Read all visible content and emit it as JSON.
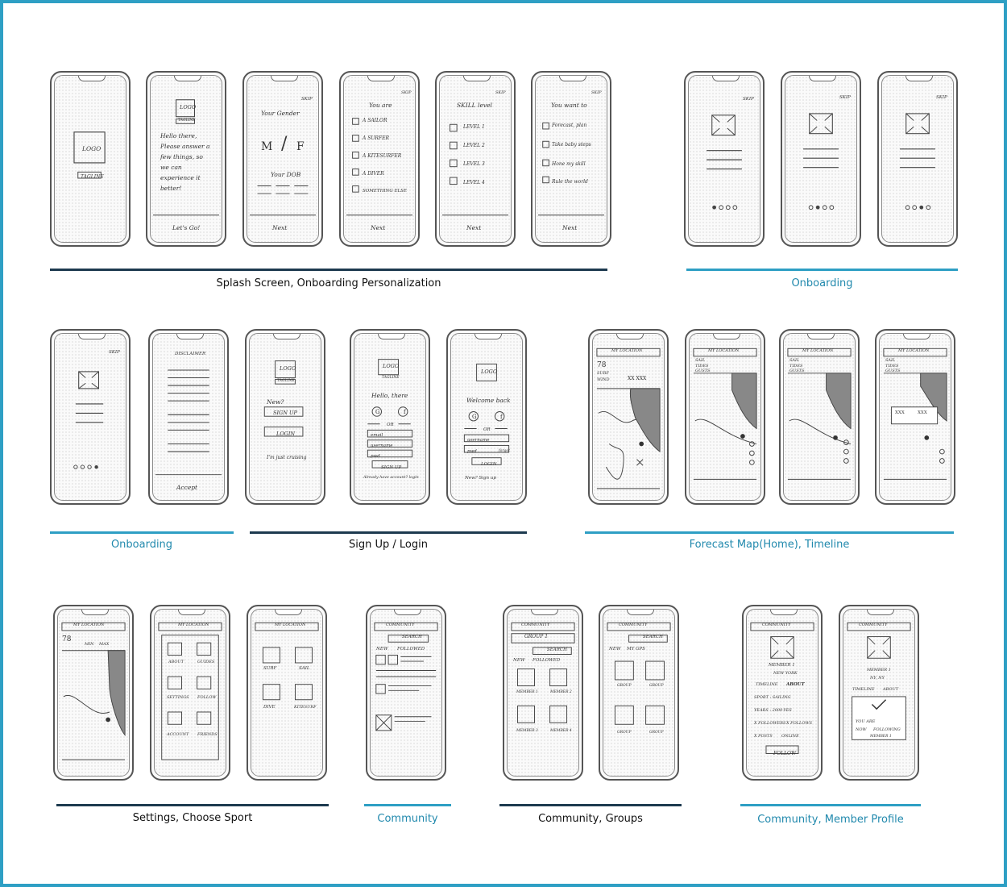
{
  "captions": [
    {
      "text": "Splash Screen, Onboarding Personalization",
      "tone": "dark"
    },
    {
      "text": "Onboarding",
      "tone": "blue"
    },
    {
      "text": "Onboarding",
      "tone": "blue"
    },
    {
      "text": "Sign Up / Login",
      "tone": "dark"
    },
    {
      "text": "Forecast Map(Home), Timeline",
      "tone": "blue"
    },
    {
      "text": "Settings, Choose Sport",
      "tone": "dark"
    },
    {
      "text": "Community",
      "tone": "blue"
    },
    {
      "text": "Community, Groups",
      "tone": "dark"
    },
    {
      "text": "Community, Member Profile",
      "tone": "blue"
    }
  ],
  "colors": {
    "frame_border": "#2e9fc4",
    "bar_dark": "#1d3a4f",
    "bar_blue": "#2e9fc4",
    "caption_blue": "#2189ad"
  },
  "screens": [
    {
      "id": "splash",
      "texts": [
        "LOGO",
        "TAGLINE"
      ]
    },
    {
      "id": "welcome",
      "texts": [
        "LOGO",
        "TAGLINE",
        "Hello there,",
        "Please answer a",
        "few things, so",
        "we can",
        "experience it",
        "better!",
        "Let's Go!"
      ]
    },
    {
      "id": "gender",
      "texts": [
        "SKIP",
        "Your Gender",
        "M",
        "/",
        "F",
        "Your DOB",
        "Next"
      ]
    },
    {
      "id": "you-are",
      "texts": [
        "SKIP",
        "You are",
        "A SAILOR",
        "A SURFER",
        "A KITESURFER",
        "A DIVER",
        "SOMETHING ELSE",
        "Next"
      ]
    },
    {
      "id": "skill",
      "texts": [
        "SKIP",
        "SKILL level",
        "LEVEL 1",
        "LEVEL 2",
        "LEVEL 3",
        "LEVEL 4",
        "Next"
      ]
    },
    {
      "id": "want-to",
      "texts": [
        "SKIP",
        "You want to",
        "Forecast, plan",
        "Take baby steps",
        "Hone my skill",
        "Rule the world",
        "Next"
      ]
    },
    {
      "id": "onb-1",
      "texts": [
        "SKIP"
      ]
    },
    {
      "id": "onb-2",
      "texts": [
        "SKIP"
      ]
    },
    {
      "id": "onb-3",
      "texts": [
        "SKIP"
      ]
    },
    {
      "id": "onb-4",
      "texts": [
        "SKIP"
      ]
    },
    {
      "id": "disclaimer",
      "texts": [
        "DISCLAIMER",
        "Accept"
      ]
    },
    {
      "id": "signup-choice",
      "texts": [
        "LOGO",
        "TAGLINE",
        "New?",
        "SIGN UP",
        "LOGIN",
        "I'm just cruising"
      ]
    },
    {
      "id": "signup",
      "texts": [
        "LOGO",
        "TAGLINE",
        "Hello, there",
        "G",
        "f",
        "OR",
        "email",
        "username",
        "pwd",
        "SIGN UP",
        "Already have account? login"
      ]
    },
    {
      "id": "login",
      "texts": [
        "LOGO",
        "Welcome back",
        "G",
        "f",
        "OR",
        "username",
        "pwd",
        "forgot",
        "LOGIN",
        "New? Sign up"
      ]
    },
    {
      "id": "map-home",
      "texts": [
        "MY LOCATION",
        "78",
        "SURF",
        "WIND",
        "XX XXX"
      ]
    },
    {
      "id": "timeline-1",
      "texts": [
        "MY LOCATION",
        "SAIL",
        "TIDES",
        "GUSTS"
      ]
    },
    {
      "id": "timeline-2",
      "texts": [
        "MY LOCATION",
        "SAIL",
        "TIDES",
        "GUSTS"
      ]
    },
    {
      "id": "timeline-3",
      "texts": [
        "MY LOCATION",
        "SAIL",
        "TIDES",
        "GUSTS",
        "XXX",
        "XXX"
      ]
    },
    {
      "id": "settings-map",
      "texts": [
        "MY LOCATION",
        "78",
        "MIN",
        "MAX"
      ]
    },
    {
      "id": "settings",
      "texts": [
        "MY LOCATION",
        "ABOUT",
        "GUIDES",
        "SETTINGS",
        "FOLLOW",
        "ACCOUNT",
        "FRIENDS"
      ]
    },
    {
      "id": "choose-sport",
      "texts": [
        "MY LOCATION",
        "SURF",
        "SAIL",
        "DIVE",
        "KITESURF"
      ]
    },
    {
      "id": "community",
      "texts": [
        "COMMUNITY",
        "SEARCH",
        "NEW",
        "FOLLOWED"
      ]
    },
    {
      "id": "groups-1",
      "texts": [
        "COMMUNITY",
        "GROUP 1",
        "SEARCH",
        "NEW",
        "FOLLOWED",
        "MEMBER 1",
        "MEMBER 2",
        "MEMBER 3",
        "MEMBER 4"
      ]
    },
    {
      "id": "groups-2",
      "texts": [
        "COMMUNITY",
        "SEARCH",
        "NEW",
        "MY GPS",
        "GROUP",
        "GROUP",
        "GROUP",
        "GROUP"
      ]
    },
    {
      "id": "member-1",
      "texts": [
        "COMMUNITY",
        "MEMBER 1",
        "NEW YORK",
        "TIMELINE",
        "ABOUT",
        "SPORT : SAILING",
        "YEARS : 2000-YES",
        "X FOLLOWERS",
        "X FOLLOWS",
        "X POSTS",
        "ONLINE",
        "FOLLOW"
      ]
    },
    {
      "id": "member-2",
      "texts": [
        "COMMUNITY",
        "MEMBER 1",
        "NY, NY",
        "TIMELINE",
        "ABOUT",
        "YOU ARE",
        "NOW",
        "FOLLOWING",
        "MEMBER 1"
      ]
    }
  ]
}
